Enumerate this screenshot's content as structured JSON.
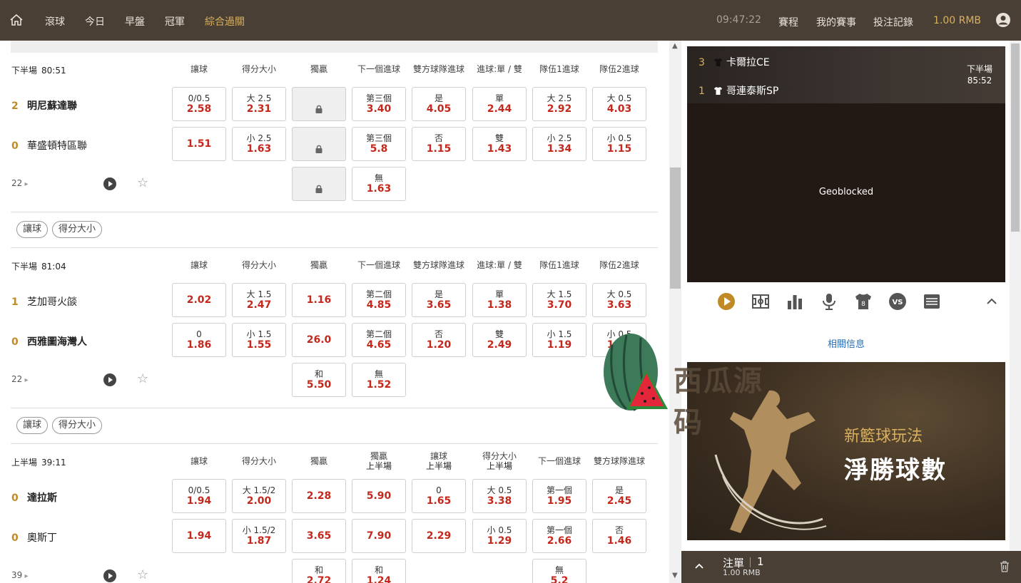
{
  "nav": {
    "items": [
      "滾球",
      "今日",
      "早盤",
      "冠軍",
      "綜合過關"
    ],
    "active": 4,
    "time": "09:47:22",
    "links": [
      "賽程",
      "我的賽事",
      "投注記錄"
    ],
    "balance": "1.00 RMB"
  },
  "games": [
    {
      "period": "下半場",
      "clock": "80:51",
      "headers": [
        [
          "讓球",
          ""
        ],
        [
          "得分大小",
          ""
        ],
        [
          "獨贏",
          ""
        ],
        [
          "下一個進球",
          ""
        ],
        [
          "雙方球隊進球",
          ""
        ],
        [
          "進球:單 / 雙",
          ""
        ],
        [
          "隊伍1進球",
          ""
        ],
        [
          "隊伍2進球",
          ""
        ]
      ],
      "teams": [
        {
          "score": "2",
          "name": "明尼蘇達聯",
          "bold": true
        },
        {
          "score": "0",
          "name": "華盛頓特區聯",
          "bold": false
        }
      ],
      "rows": [
        [
          {
            "l": "0/0.5",
            "o": "2.58"
          },
          {
            "l": "大 2.5",
            "o": "2.31"
          },
          {
            "lock": true
          },
          {
            "l": "第三個",
            "o": "3.40"
          },
          {
            "l": "是",
            "o": "4.05"
          },
          {
            "l": "單",
            "o": "2.44"
          },
          {
            "l": "大 2.5",
            "o": "2.92"
          },
          {
            "l": "大 0.5",
            "o": "4.03"
          }
        ],
        [
          {
            "l": "",
            "o": "1.51"
          },
          {
            "l": "小 2.5",
            "o": "1.63"
          },
          {
            "lock": true
          },
          {
            "l": "第三個",
            "o": "5.8"
          },
          {
            "l": "否",
            "o": "1.15"
          },
          {
            "l": "雙",
            "o": "1.43"
          },
          {
            "l": "小 2.5",
            "o": "1.34"
          },
          {
            "l": "小 0.5",
            "o": "1.15"
          }
        ],
        [
          null,
          null,
          {
            "lock": true
          },
          {
            "l": "無",
            "o": "1.63"
          },
          null,
          null,
          null,
          null
        ]
      ],
      "more": "22"
    },
    {
      "period": "下半場",
      "clock": "81:04",
      "headers": [
        [
          "讓球",
          ""
        ],
        [
          "得分大小",
          ""
        ],
        [
          "獨贏",
          ""
        ],
        [
          "下一個進球",
          ""
        ],
        [
          "雙方球隊進球",
          ""
        ],
        [
          "進球:單 / 雙",
          ""
        ],
        [
          "隊伍1進球",
          ""
        ],
        [
          "隊伍2進球",
          ""
        ]
      ],
      "teams": [
        {
          "score": "1",
          "name": "芝加哥火燄",
          "bold": false
        },
        {
          "score": "0",
          "name": "西雅圖海灣人",
          "bold": true
        }
      ],
      "rows": [
        [
          {
            "l": "",
            "o": "2.02"
          },
          {
            "l": "大 1.5",
            "o": "2.47"
          },
          {
            "l": "",
            "o": "1.16"
          },
          {
            "l": "第二個",
            "o": "4.85"
          },
          {
            "l": "是",
            "o": "3.65"
          },
          {
            "l": "單",
            "o": "1.38"
          },
          {
            "l": "大 1.5",
            "o": "3.70"
          },
          {
            "l": "大 0.5",
            "o": "3.63"
          }
        ],
        [
          {
            "l": "0",
            "o": "1.86"
          },
          {
            "l": "小 1.5",
            "o": "1.55"
          },
          {
            "l": "",
            "o": "26.0"
          },
          {
            "l": "第二個",
            "o": "4.65"
          },
          {
            "l": "否",
            "o": "1.20"
          },
          {
            "l": "雙",
            "o": "2.49"
          },
          {
            "l": "小 1.5",
            "o": "1.19"
          },
          {
            "l": "小 0.5",
            "o": "1.16"
          }
        ],
        [
          null,
          null,
          {
            "l": "和",
            "o": "5.50"
          },
          {
            "l": "無",
            "o": "1.52"
          },
          null,
          null,
          null,
          null
        ]
      ],
      "more": "22"
    },
    {
      "period": "上半場",
      "clock": "39:11",
      "headers": [
        [
          "讓球",
          ""
        ],
        [
          "得分大小",
          ""
        ],
        [
          "獨贏",
          ""
        ],
        [
          "獨贏",
          "上半場"
        ],
        [
          "讓球",
          "上半場"
        ],
        [
          "得分大小",
          "上半場"
        ],
        [
          "下一個進球",
          ""
        ],
        [
          "雙方球隊進球",
          ""
        ]
      ],
      "teams": [
        {
          "score": "0",
          "name": "達拉斯",
          "bold": true
        },
        {
          "score": "0",
          "name": "奧斯丁",
          "bold": false
        }
      ],
      "rows": [
        [
          {
            "l": "0/0.5",
            "o": "1.94"
          },
          {
            "l": "大 1.5/2",
            "o": "2.00"
          },
          {
            "l": "",
            "o": "2.28"
          },
          {
            "l": "",
            "o": "5.90"
          },
          {
            "l": "0",
            "o": "1.65"
          },
          {
            "l": "大 0.5",
            "o": "3.38"
          },
          {
            "l": "第一個",
            "o": "1.95"
          },
          {
            "l": "是",
            "o": "2.45"
          }
        ],
        [
          {
            "l": "",
            "o": "1.94"
          },
          {
            "l": "小 1.5/2",
            "o": "1.87"
          },
          {
            "l": "",
            "o": "3.65"
          },
          {
            "l": "",
            "o": "7.90"
          },
          {
            "l": "",
            "o": "2.29"
          },
          {
            "l": "小 0.5",
            "o": "1.29"
          },
          {
            "l": "第一個",
            "o": "2.66"
          },
          {
            "l": "否",
            "o": "1.46"
          }
        ],
        [
          null,
          null,
          {
            "l": "和",
            "o": "2.72"
          },
          {
            "l": "和",
            "o": "1.24"
          },
          null,
          null,
          {
            "l": "無",
            "o": "5.2"
          },
          null
        ]
      ],
      "more": "39"
    }
  ],
  "market_tags": [
    "讓球",
    "得分大小"
  ],
  "video": {
    "team1": {
      "score": "3",
      "name": "卡爾拉CE"
    },
    "team2": {
      "score": "1",
      "name": "哥連泰斯SP"
    },
    "period": "下半場",
    "clock": "85:52",
    "message": "Geoblocked"
  },
  "related": "相關信息",
  "banner": {
    "line1": "新籃球玩法",
    "line2": "淨勝球數"
  },
  "betslip": {
    "label": "注單",
    "count": "1",
    "amount": "1.00 RMB"
  },
  "watermark": "西瓜源码",
  "colors": {
    "topbar": "#4a3f35",
    "odds": "#c4281c",
    "gold": "#d9b05c",
    "score": "#c08a27",
    "link": "#2a6db5"
  }
}
